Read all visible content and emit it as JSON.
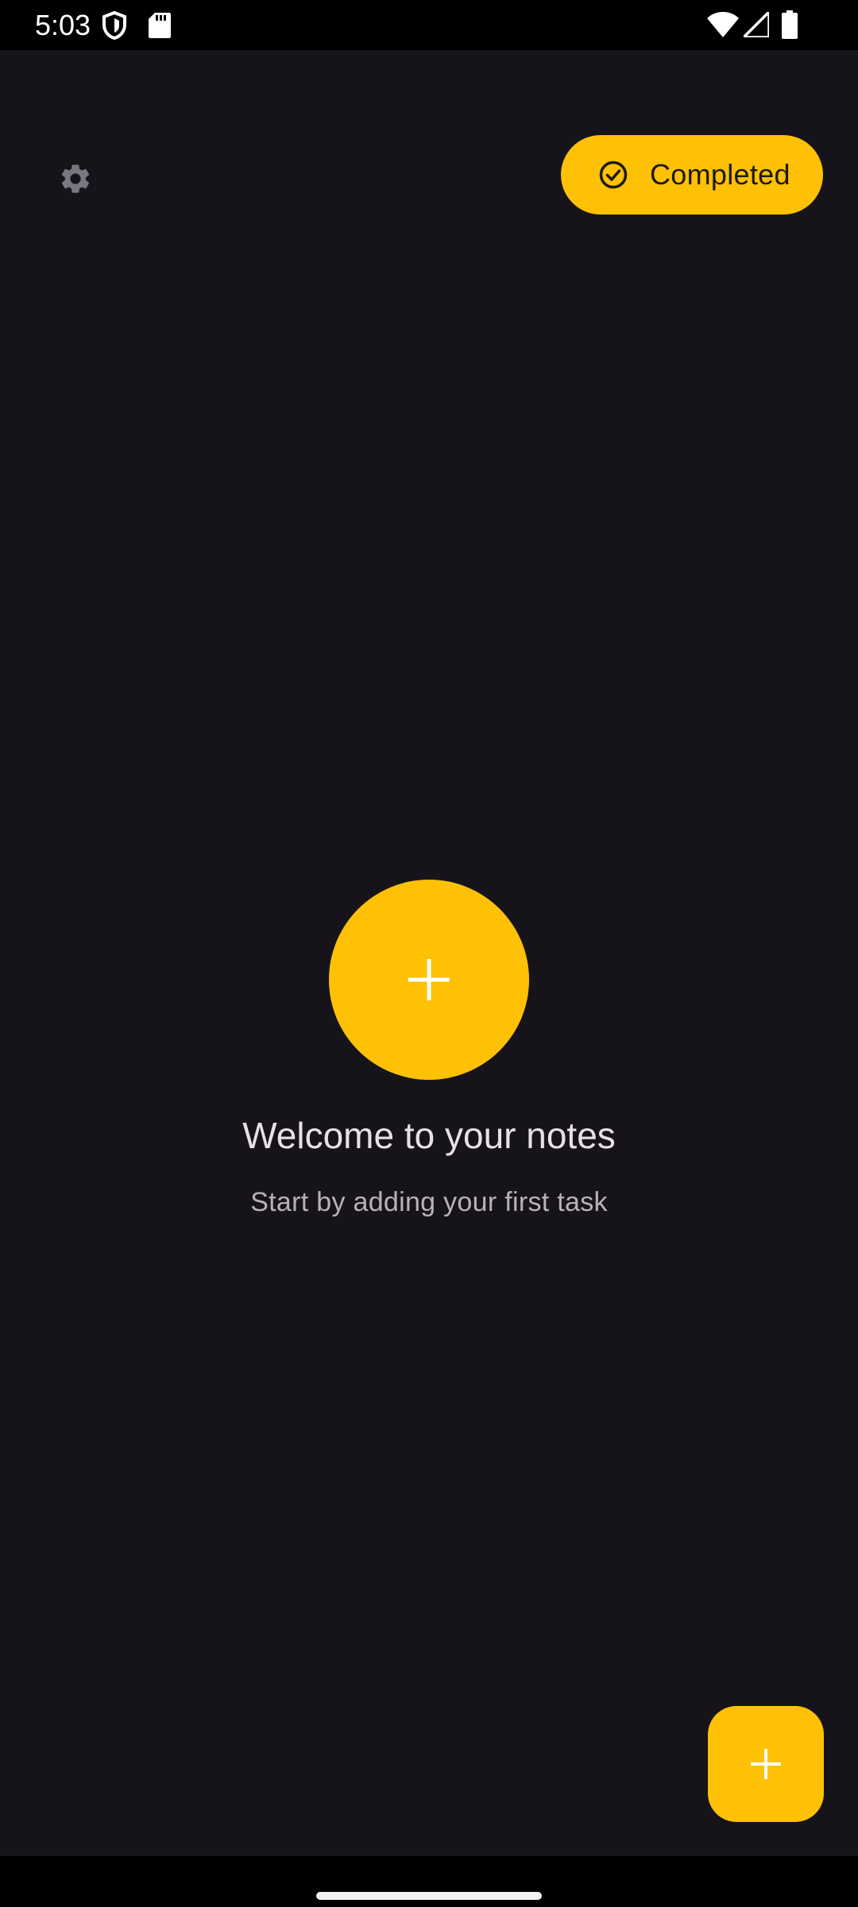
{
  "status_bar": {
    "time": "5:03",
    "icons": [
      "shield-icon",
      "sd-card-icon",
      "wifi-icon",
      "cell-signal-icon",
      "battery-icon"
    ]
  },
  "header": {
    "settings_icon": "gear-icon",
    "completed_chip": {
      "icon": "check-circle-icon",
      "label": "Completed"
    }
  },
  "empty_state": {
    "add_icon": "plus-icon",
    "title": "Welcome to your notes",
    "subtitle": "Start by adding your first task"
  },
  "fab": {
    "icon": "plus-icon"
  },
  "colors": {
    "background": "#16141a",
    "accent": "#fec106",
    "title_text": "#e6e1e8",
    "subtitle_text": "#b7b2ba",
    "settings_icon": "#7a7780"
  }
}
